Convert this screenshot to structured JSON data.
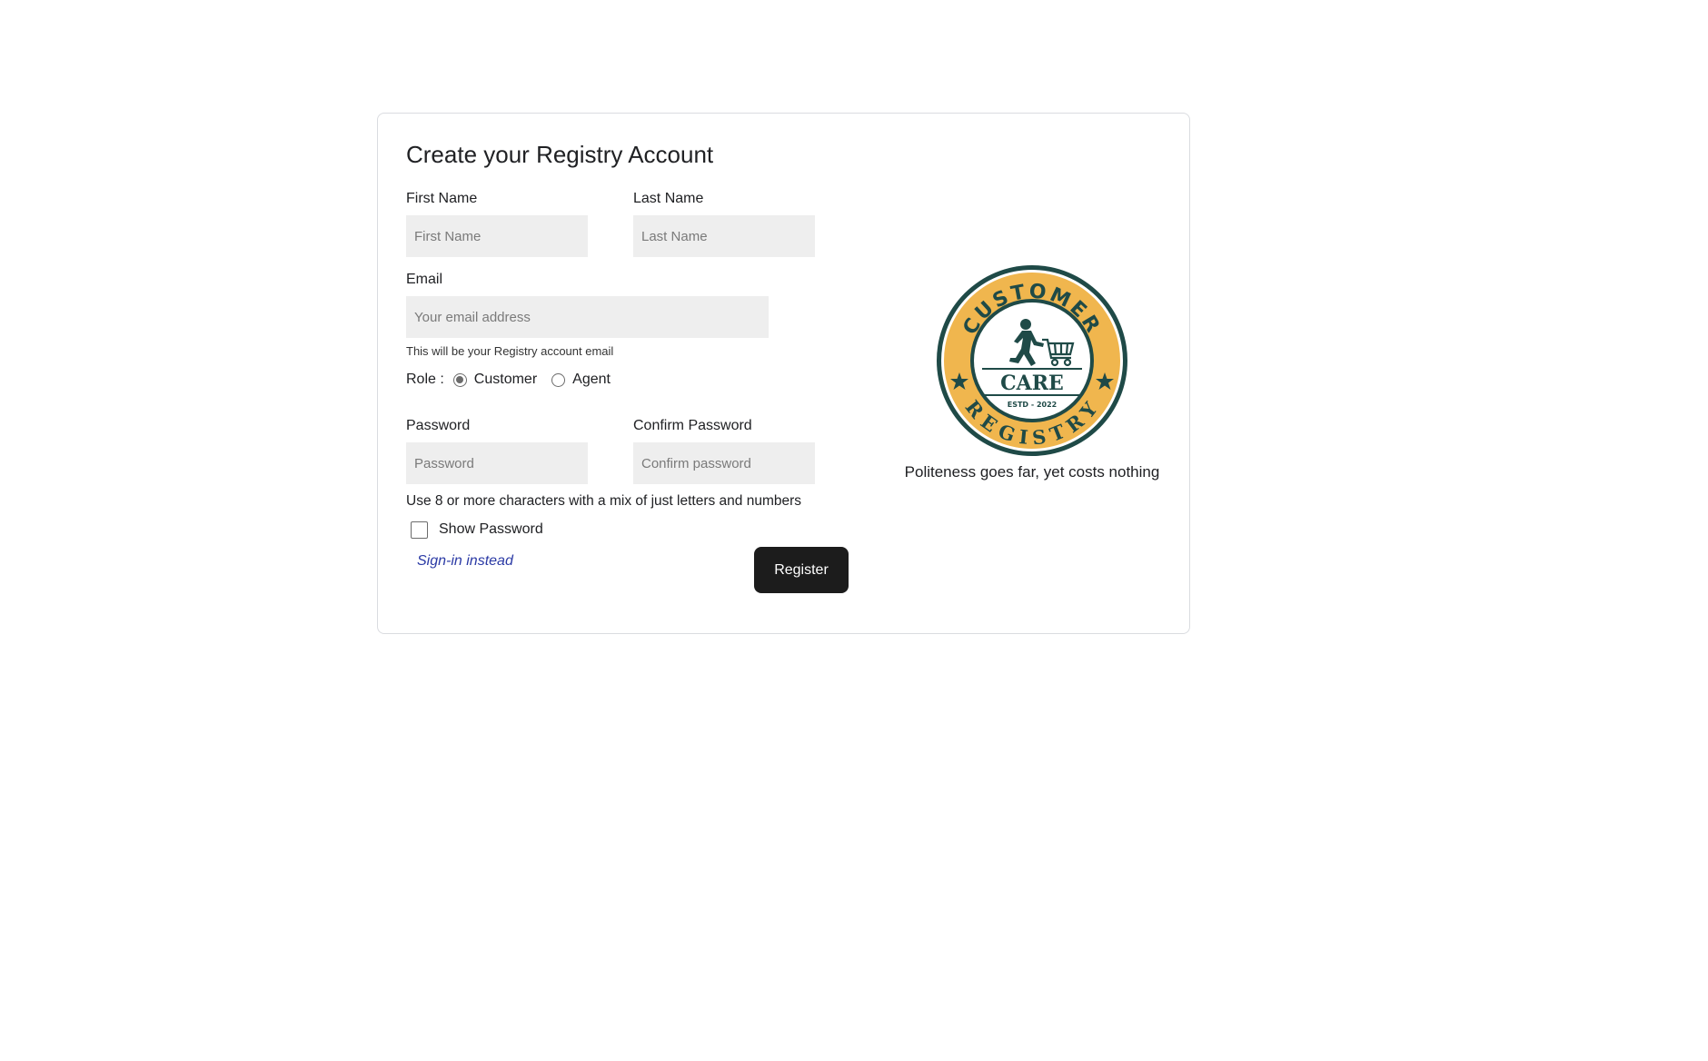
{
  "form": {
    "title": "Create your Registry Account",
    "first_name": {
      "label": "First Name",
      "placeholder": "First Name",
      "value": ""
    },
    "last_name": {
      "label": "Last Name",
      "placeholder": "Last Name",
      "value": ""
    },
    "email": {
      "label": "Email",
      "placeholder": "Your email address",
      "value": "",
      "hint": "This will be your Registry account email"
    },
    "role": {
      "label": "Role :",
      "options": [
        {
          "label": "Customer",
          "selected": true
        },
        {
          "label": "Agent",
          "selected": false
        }
      ]
    },
    "password": {
      "label": "Password",
      "placeholder": "Password",
      "value": ""
    },
    "confirm_password": {
      "label": "Confirm Password",
      "placeholder": "Confirm password",
      "value": ""
    },
    "password_hint": "Use 8 or more characters with a mix of just letters and numbers",
    "show_password": {
      "label": "Show Password",
      "checked": false
    },
    "signin_link": "Sign-in instead",
    "register_button": "Register"
  },
  "brand": {
    "logo": {
      "top_text": "CUSTOMER",
      "center_text": "CARE",
      "estd_text": "ESTD - 2022",
      "bottom_text": "REGISTRY",
      "colors": {
        "ring": "#f0b64e",
        "dark": "#1f4a47",
        "inner": "#ffffff"
      }
    },
    "tagline": "Politeness goes far, yet costs nothing"
  }
}
